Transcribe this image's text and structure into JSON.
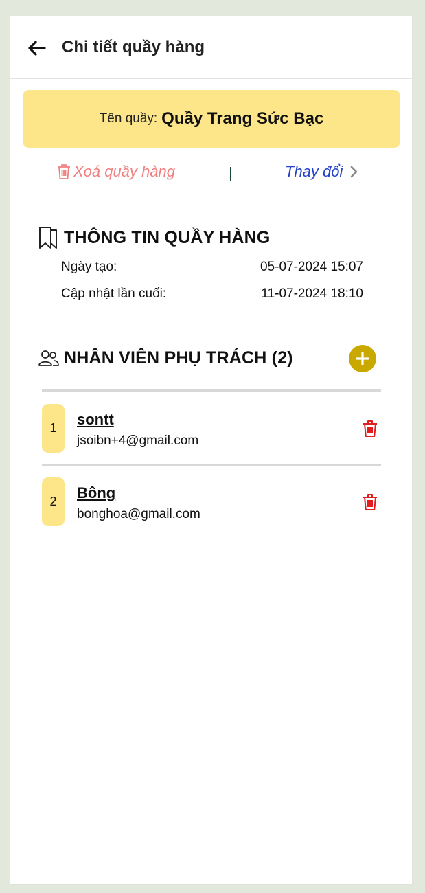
{
  "header": {
    "title": "Chi tiết quầy hàng",
    "back_icon": "arrow-left-icon"
  },
  "counter": {
    "name_label": "Tên quầy:",
    "name_value": "Quầy Trang Sức Bạc",
    "banner_color": "#fde68a"
  },
  "actions": {
    "delete_label": "Xoá quầy hàng",
    "separator": "|",
    "change_label": "Thay đổi",
    "delete_color": "#f08080",
    "change_color": "#2443c8"
  },
  "info": {
    "title": "THÔNG TIN QUẦY HÀNG",
    "created_label": "Ngày tạo:",
    "created_value": "05-07-2024 15:07",
    "updated_label": "Cập nhật lần cuối:",
    "updated_value": "11-07-2024 18:10"
  },
  "staff": {
    "title": "NHÂN VIÊN PHỤ TRÁCH (2)",
    "add_button_color": "#c9a800",
    "members": [
      {
        "index": "1",
        "name": "sontt",
        "email": "jsoibn+4@gmail.com"
      },
      {
        "index": "2",
        "name": "Bông",
        "email": "bonghoa@gmail.com"
      }
    ]
  }
}
